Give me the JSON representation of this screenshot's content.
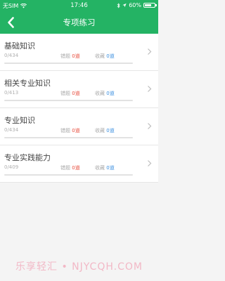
{
  "status_bar": {
    "carrier": "无SIM",
    "time": "17:46",
    "battery": "60%"
  },
  "nav": {
    "title": "专项练习",
    "back_icon": "chevron-left-icon"
  },
  "labels": {
    "wrong": "错题",
    "favorite": "收藏"
  },
  "sections": [
    {
      "title": "基础知识",
      "progress": "0/434",
      "wrong": "0道",
      "favorite": "0道",
      "completion": 0
    },
    {
      "title": "相关专业知识",
      "progress": "0/413",
      "wrong": "0道",
      "favorite": "0道",
      "completion": 0
    },
    {
      "title": "专业知识",
      "progress": "0/434",
      "wrong": "0道",
      "favorite": "0道",
      "completion": 0
    },
    {
      "title": "专业实践能力",
      "progress": "0/409",
      "wrong": "0道",
      "favorite": "0道",
      "completion": 0
    }
  ],
  "watermark": "乐享轻汇 • NJYCQH.COM",
  "colors": {
    "accent": "#24b364",
    "wrong_count": "#e74c3c",
    "favorite_count": "#3b8fe0"
  }
}
